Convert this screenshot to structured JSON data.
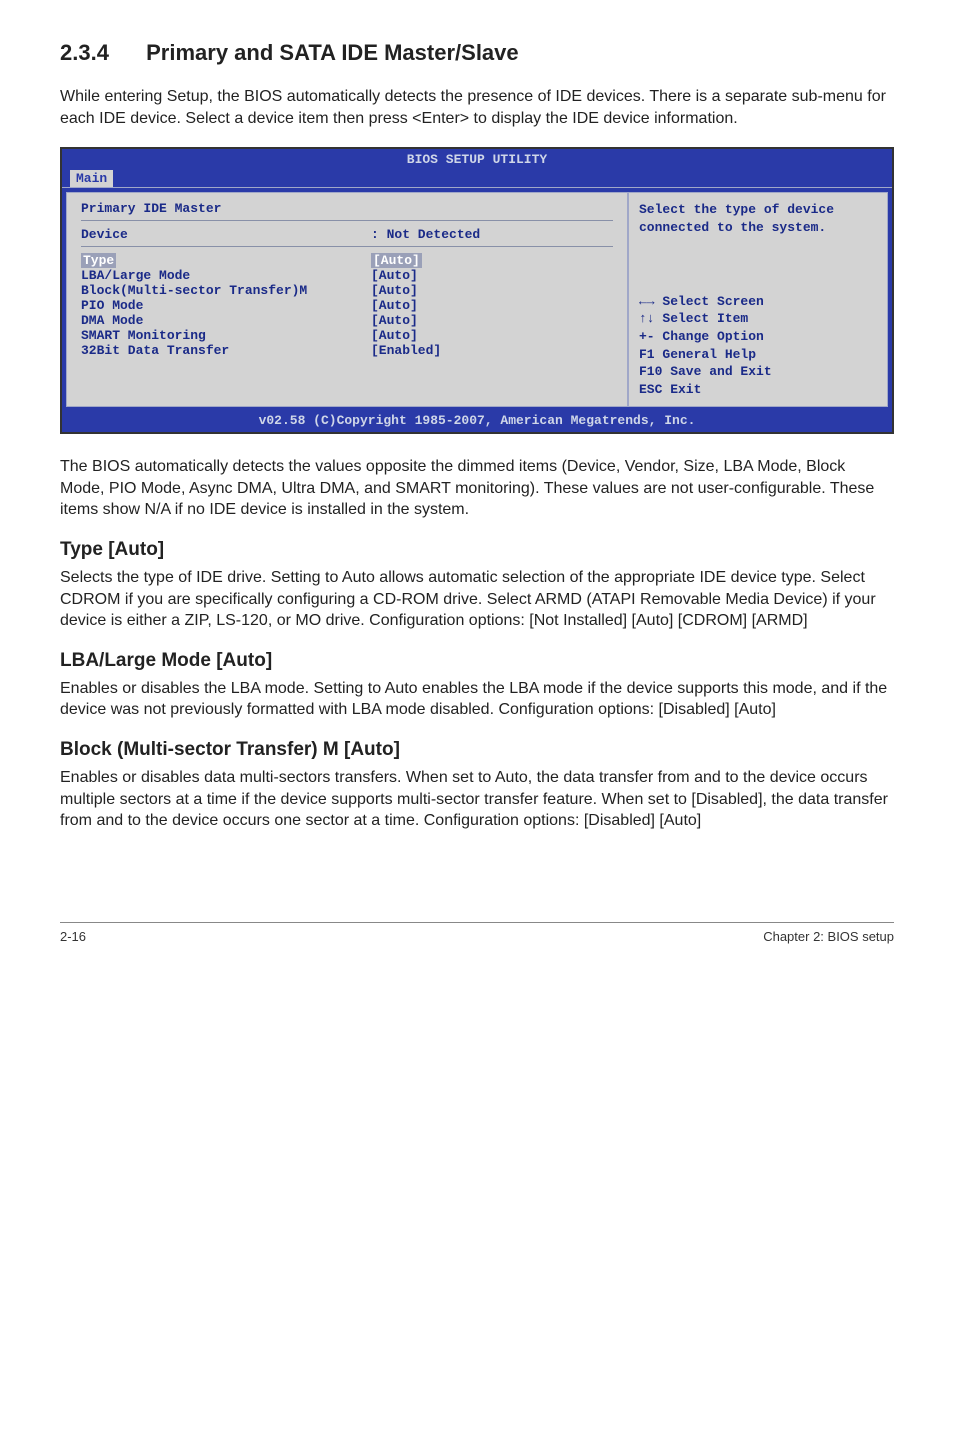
{
  "section": {
    "number": "2.3.4",
    "title": "Primary and SATA IDE Master/Slave",
    "intro": "While entering Setup, the BIOS automatically detects the presence of IDE devices. There is a separate sub-menu for each IDE device. Select a device item then press <Enter> to display the IDE device information."
  },
  "bios": {
    "title": "BIOS SETUP UTILITY",
    "tab": "Main",
    "header_line": "Primary IDE Master",
    "device_label": "Device",
    "device_value": ": Not Detected",
    "rows": [
      {
        "k": "Type",
        "v": "[Auto]",
        "hilite": true
      },
      {
        "k": "LBA/Large Mode",
        "v": "[Auto]",
        "hilite": false
      },
      {
        "k": "Block(Multi-sector Transfer)M",
        "v": "[Auto]",
        "hilite": false
      },
      {
        "k": "PIO Mode",
        "v": "[Auto]",
        "hilite": false
      },
      {
        "k": "DMA Mode",
        "v": "[Auto]",
        "hilite": false
      },
      {
        "k": "SMART Monitoring",
        "v": "[Auto]",
        "hilite": false
      },
      {
        "k": "32Bit Data Transfer",
        "v": "[Enabled]",
        "hilite": false
      }
    ],
    "help": "Select the type of device connected to the system.",
    "keys": [
      "←→ Select Screen",
      "↑↓  Select Item",
      "+-  Change Option",
      "F1  General Help",
      "F10 Save and Exit",
      "ESC Exit"
    ],
    "footer": "v02.58 (C)Copyright 1985-2007, American Megatrends, Inc."
  },
  "after_bios": "The BIOS automatically detects the values opposite the dimmed items (Device, Vendor, Size, LBA Mode, Block Mode, PIO Mode, Async DMA, Ultra DMA, and SMART monitoring). These values are not user-configurable. These items show N/A if no IDE device is installed in the system.",
  "subs": [
    {
      "title": "Type [Auto]",
      "body": "Selects the type of IDE drive. Setting to Auto allows automatic selection of the appropriate IDE device type. Select CDROM if you are specifically configuring a CD-ROM drive. Select ARMD (ATAPI Removable Media Device) if your device is either a ZIP, LS-120, or MO drive. Configuration options: [Not Installed] [Auto] [CDROM] [ARMD]"
    },
    {
      "title": "LBA/Large Mode [Auto]",
      "body": "Enables or disables the LBA mode. Setting to Auto enables the LBA mode if the device supports this mode, and if the device was not previously formatted with LBA mode disabled. Configuration options: [Disabled] [Auto]"
    },
    {
      "title": "Block (Multi-sector Transfer) M [Auto]",
      "body": "Enables or disables data multi-sectors transfers. When set to Auto, the data transfer from and to the device occurs multiple sectors at a time if the device supports multi-sector transfer feature. When set to [Disabled], the data transfer from and to the device occurs one sector at a time. Configuration options: [Disabled] [Auto]"
    }
  ],
  "footer": {
    "left": "2-16",
    "right": "Chapter 2: BIOS setup"
  }
}
